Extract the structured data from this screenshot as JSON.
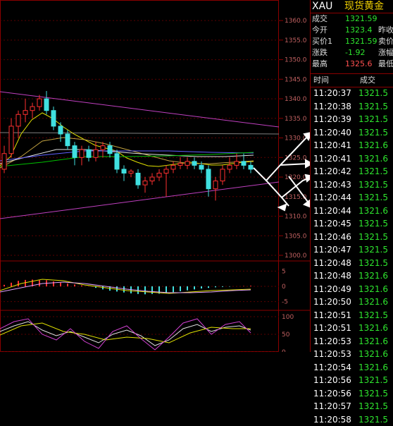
{
  "quote": {
    "symbol": "XAU",
    "name": "现货黄金",
    "rows": [
      {
        "label": "成交",
        "value": "1321.59",
        "extra": ""
      },
      {
        "label": "今开",
        "value": "1323.4",
        "extra": "昨收"
      },
      {
        "label": "买价1",
        "value": "1321.59",
        "extra": "卖价"
      },
      {
        "label": "涨跌",
        "value": "-1.92",
        "extra": "涨幅"
      },
      {
        "label": "最高",
        "value": "1325.6",
        "extra": "最低"
      }
    ]
  },
  "ticks": {
    "header_time": "时间",
    "header_price": "成交",
    "rows": [
      {
        "time": "11:20:37",
        "price": "1321.5"
      },
      {
        "time": "11:20:38",
        "price": "1321.5"
      },
      {
        "time": "11:20:39",
        "price": "1321.5"
      },
      {
        "time": "11:20:40",
        "price": "1321.5"
      },
      {
        "time": "11:20:41",
        "price": "1321.6"
      },
      {
        "time": "11:20:41",
        "price": "1321.6"
      },
      {
        "time": "11:20:42",
        "price": "1321.5"
      },
      {
        "time": "11:20:43",
        "price": "1321.5"
      },
      {
        "time": "11:20:44",
        "price": "1321.5"
      },
      {
        "time": "11:20:44",
        "price": "1321.6"
      },
      {
        "time": "11:20:45",
        "price": "1321.5"
      },
      {
        "time": "11:20:46",
        "price": "1321.5"
      },
      {
        "time": "11:20:47",
        "price": "1321.5"
      },
      {
        "time": "11:20:48",
        "price": "1321.5"
      },
      {
        "time": "11:20:48",
        "price": "1321.6"
      },
      {
        "time": "11:20:49",
        "price": "1321.6"
      },
      {
        "time": "11:20:50",
        "price": "1321.6"
      },
      {
        "time": "11:20:51",
        "price": "1321.5"
      },
      {
        "time": "11:20:51",
        "price": "1321.6"
      },
      {
        "time": "11:20:53",
        "price": "1321.6"
      },
      {
        "time": "11:20:53",
        "price": "1321.6"
      },
      {
        "time": "11:20:54",
        "price": "1321.6"
      },
      {
        "time": "11:20:56",
        "price": "1321.5"
      },
      {
        "time": "11:20:56",
        "price": "1321.5"
      },
      {
        "time": "11:20:57",
        "price": "1321.5"
      },
      {
        "time": "11:20:58",
        "price": "1321.5"
      }
    ]
  },
  "chart_data": {
    "type": "candlestick",
    "main_axis_labels": [
      "1360.0",
      "1355.0",
      "1350.0",
      "1345.0",
      "1340.0",
      "1335.0",
      "1330.0",
      "1325.0",
      "1320.0",
      "1315.0",
      "1310.0",
      "1305.0",
      "1300.0"
    ],
    "main_ylim": [
      1300,
      1362
    ],
    "candles": [
      {
        "o": 1322,
        "c": 1326,
        "h": 1328,
        "l": 1321
      },
      {
        "o": 1326,
        "c": 1333,
        "h": 1335,
        "l": 1325
      },
      {
        "o": 1333,
        "c": 1336,
        "h": 1337,
        "l": 1330
      },
      {
        "o": 1336,
        "c": 1337,
        "h": 1340,
        "l": 1334
      },
      {
        "o": 1337,
        "c": 1338,
        "h": 1339,
        "l": 1335
      },
      {
        "o": 1338,
        "c": 1340,
        "h": 1341,
        "l": 1337
      },
      {
        "o": 1340,
        "c": 1337,
        "h": 1342,
        "l": 1336
      },
      {
        "o": 1337,
        "c": 1333,
        "h": 1338,
        "l": 1332
      },
      {
        "o": 1333,
        "c": 1331,
        "h": 1334,
        "l": 1329
      },
      {
        "o": 1331,
        "c": 1328,
        "h": 1332,
        "l": 1327
      },
      {
        "o": 1328,
        "c": 1325,
        "h": 1329,
        "l": 1323
      },
      {
        "o": 1325,
        "c": 1327,
        "h": 1328,
        "l": 1323
      },
      {
        "o": 1327,
        "c": 1325,
        "h": 1328,
        "l": 1324
      },
      {
        "o": 1325,
        "c": 1327,
        "h": 1329,
        "l": 1324
      },
      {
        "o": 1327,
        "c": 1328,
        "h": 1329,
        "l": 1325
      },
      {
        "o": 1328,
        "c": 1326,
        "h": 1329,
        "l": 1325
      },
      {
        "o": 1326,
        "c": 1322,
        "h": 1327,
        "l": 1321
      },
      {
        "o": 1322,
        "c": 1321,
        "h": 1323,
        "l": 1319
      },
      {
        "o": 1321,
        "c": 1321.5,
        "h": 1322,
        "l": 1320
      },
      {
        "o": 1321,
        "c": 1318,
        "h": 1322,
        "l": 1317
      },
      {
        "o": 1318,
        "c": 1319,
        "h": 1320,
        "l": 1316
      },
      {
        "o": 1319,
        "c": 1320,
        "h": 1321,
        "l": 1318
      },
      {
        "o": 1320,
        "c": 1321,
        "h": 1322,
        "l": 1319
      },
      {
        "o": 1321,
        "c": 1322,
        "h": 1323,
        "l": 1315
      },
      {
        "o": 1322,
        "c": 1323,
        "h": 1324,
        "l": 1321
      },
      {
        "o": 1323,
        "c": 1323.5,
        "h": 1325,
        "l": 1322
      },
      {
        "o": 1323,
        "c": 1324,
        "h": 1325,
        "l": 1322
      },
      {
        "o": 1324,
        "c": 1323,
        "h": 1325,
        "l": 1322
      },
      {
        "o": 1323,
        "c": 1322,
        "h": 1324,
        "l": 1321
      },
      {
        "o": 1322,
        "c": 1317,
        "h": 1323,
        "l": 1315
      },
      {
        "o": 1317,
        "c": 1319,
        "h": 1320,
        "l": 1314
      },
      {
        "o": 1319,
        "c": 1322,
        "h": 1323,
        "l": 1318
      },
      {
        "o": 1322,
        "c": 1323,
        "h": 1325,
        "l": 1321
      },
      {
        "o": 1323,
        "c": 1324,
        "h": 1326,
        "l": 1322
      },
      {
        "o": 1324,
        "c": 1323,
        "h": 1326,
        "l": 1322
      },
      {
        "o": 1323,
        "c": 1322,
        "h": 1324,
        "l": 1321
      }
    ],
    "macd_axis_labels": [
      "5",
      "0",
      "-5"
    ],
    "macd_ylim": [
      -6,
      6
    ],
    "macd_hist": [
      0.5,
      1.2,
      1.8,
      2.1,
      2.2,
      2.0,
      2.0,
      1.6,
      1.2,
      0.9,
      0.6,
      0.3,
      0.0,
      -0.5,
      -1.0,
      -1.4,
      -1.7,
      -2.0,
      -2.3,
      -2.5,
      -2.6,
      -2.5,
      -2.4,
      -2.2,
      -1.9,
      -1.6,
      -1.3,
      -1.0,
      -0.7,
      -0.5,
      -0.3,
      -0.2,
      -0.1,
      0.0,
      0.1,
      0.2
    ],
    "kdj_axis_labels": [
      "100",
      "50",
      "0"
    ],
    "kdj_ylim": [
      0,
      110
    ]
  }
}
